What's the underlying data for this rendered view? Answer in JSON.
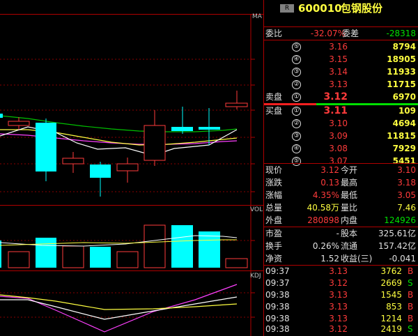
{
  "colors": {
    "up": "#ff3b3b",
    "down": "#00ffff",
    "ma5": "#ffffff",
    "ma10": "#ffff40",
    "ma20": "#ff40ff",
    "ma60": "#00c000"
  },
  "chart": {
    "main_label": "MA",
    "vol_label": "VOL",
    "kdj_label": "KDJ"
  },
  "header": {
    "badge": "R",
    "code": "600010",
    "name": "包钢股份"
  },
  "weibi": {
    "label": "委比",
    "value": "-32.07%",
    "diff_label": "委差",
    "diff": "-28318"
  },
  "sell": [
    {
      "label": "",
      "idx": "⑤",
      "price": "3.16",
      "vol": "8794"
    },
    {
      "label": "",
      "idx": "④",
      "price": "3.15",
      "vol": "18905"
    },
    {
      "label": "",
      "idx": "③",
      "price": "3.14",
      "vol": "11933"
    },
    {
      "label": "",
      "idx": "②",
      "price": "3.13",
      "vol": "11715"
    },
    {
      "label": "卖盘",
      "idx": "①",
      "price": "3.12",
      "vol": "6970"
    }
  ],
  "buy": [
    {
      "label": "买盘",
      "idx": "①",
      "price": "3.11",
      "vol": "109"
    },
    {
      "label": "",
      "idx": "②",
      "price": "3.10",
      "vol": "4694"
    },
    {
      "label": "",
      "idx": "③",
      "price": "3.09",
      "vol": "11815"
    },
    {
      "label": "",
      "idx": "④",
      "price": "3.08",
      "vol": "7929"
    },
    {
      "label": "",
      "idx": "⑤",
      "price": "3.07",
      "vol": "5451"
    }
  ],
  "quote": [
    {
      "l1": "现价",
      "v1": "3.12",
      "l2": "今开",
      "v2": "3.10",
      "c1": "red",
      "c2": "red"
    },
    {
      "l1": "涨跌",
      "v1": "0.13",
      "l2": "最高",
      "v2": "3.18",
      "c1": "red",
      "c2": "red"
    },
    {
      "l1": "涨幅",
      "v1": "4.35%",
      "l2": "最低",
      "v2": "3.05",
      "c1": "red",
      "c2": "red"
    },
    {
      "l1": "总量",
      "v1": "40.58万",
      "l2": "量比",
      "v2": "7.46",
      "c1": "yel",
      "c2": "yel"
    },
    {
      "l1": "外盘",
      "v1": "280898",
      "l2": "内盘",
      "v2": "124926",
      "c1": "red",
      "c2": "grn"
    }
  ],
  "fund": [
    {
      "l1": "市盈",
      "v1": "-",
      "l2": "股本",
      "v2": "325.61亿"
    },
    {
      "l1": "换手",
      "v1": "0.26%",
      "l2": "流通",
      "v2": "157.42亿"
    },
    {
      "l1": "净资",
      "v1": "1.52",
      "l2": "收益(三)",
      "v2": "-0.041"
    }
  ],
  "ticks": [
    {
      "time": "09:37",
      "price": "3.13",
      "vol": "3762",
      "side": "B"
    },
    {
      "time": "09:37",
      "price": "3.12",
      "vol": "2669",
      "side": "S"
    },
    {
      "time": "09:38",
      "price": "3.13",
      "vol": "1545",
      "side": "B"
    },
    {
      "time": "09:38",
      "price": "3.13",
      "vol": "853",
      "side": "B"
    },
    {
      "time": "09:38",
      "price": "3.13",
      "vol": "1214",
      "side": "B"
    },
    {
      "time": "09:38",
      "price": "3.12",
      "vol": "2419",
      "side": "S"
    }
  ]
}
